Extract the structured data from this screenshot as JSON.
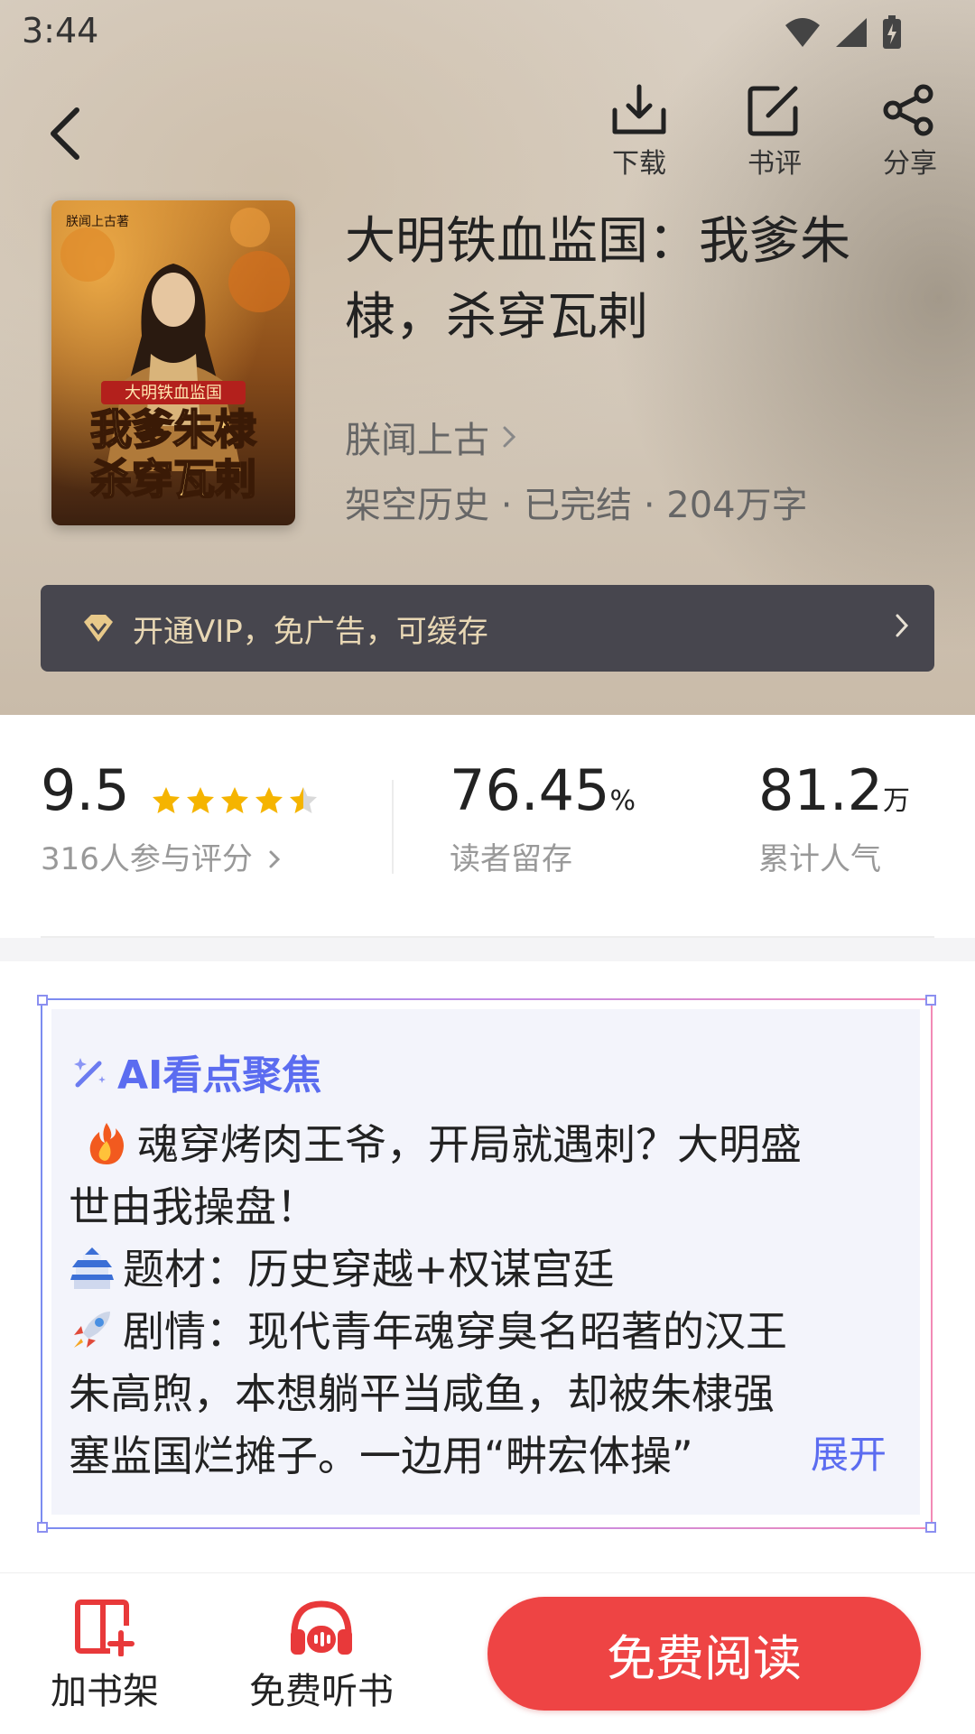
{
  "status_bar": {
    "time": "3:44"
  },
  "header": {
    "actions": [
      {
        "label": "下载",
        "icon": "download-icon"
      },
      {
        "label": "书评",
        "icon": "edit-icon"
      },
      {
        "label": "分享",
        "icon": "share-icon"
      }
    ]
  },
  "book": {
    "title": "大明铁血监国：我爹朱棣，杀穿瓦剌",
    "author": "朕闻上古",
    "meta": "架空历史 · 已完结 · 204万字",
    "cover": {
      "top_text": "朕闻上古著",
      "banner": "大明铁血监国",
      "line1": "我爹朱棣",
      "line2": "杀穿瓦剌"
    }
  },
  "vip": {
    "text": "开通VIP，免广告，可缓存",
    "icon": "diamond-icon"
  },
  "stats": {
    "rating": {
      "value": "9.5",
      "stars": 4.5,
      "label": "316人参与评分"
    },
    "retention": {
      "value": "76.45",
      "unit": "%",
      "label": "读者留存"
    },
    "popularity": {
      "value": "81.2",
      "unit": "万",
      "label": "累计人气"
    }
  },
  "ai_focus": {
    "title": "AI看点聚焦",
    "lines": [
      "魂穿烤肉王爷，开局就遇刺？大明盛",
      "世由我操盘！",
      "题材：历史穿越+权谋宫廷",
      "剧情：现代青年魂穿臭名昭著的汉王",
      "朱高煦，本想躺平当咸鱼，却被朱棣强",
      "塞监国烂摊子。一边用“畊宏体操”"
    ],
    "expand": "展开"
  },
  "bottom_bar": {
    "add_shelf": "加书架",
    "listen": "免费听书",
    "read": "免费阅读"
  },
  "colors": {
    "accent_blue": "#5b6cf0",
    "read_button": "#ee4444",
    "star": "#f5b400",
    "vip_bg": "#47464e"
  }
}
